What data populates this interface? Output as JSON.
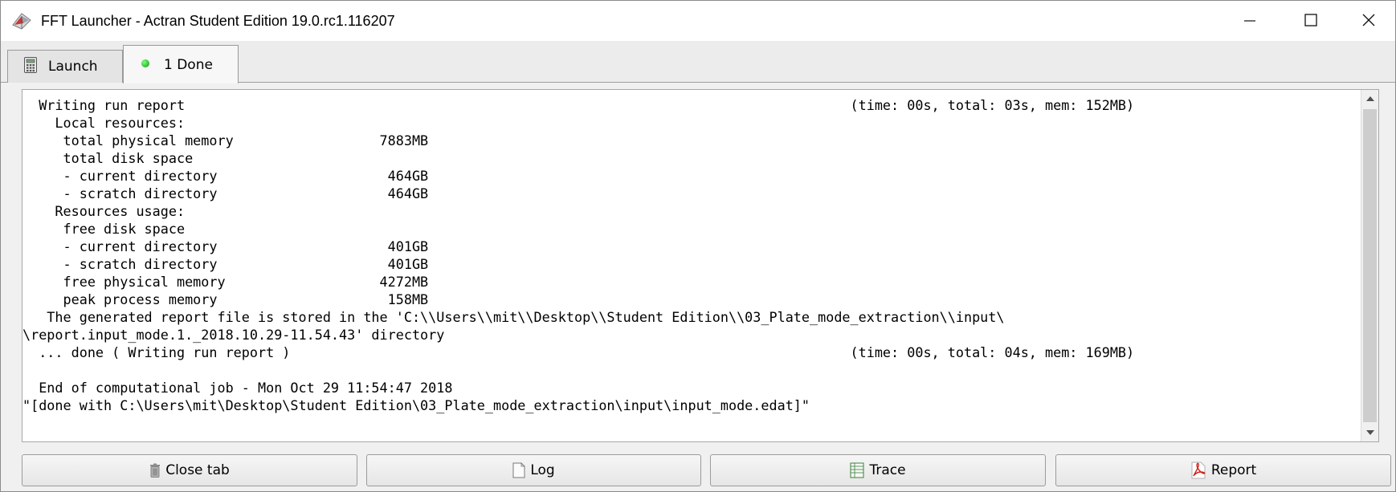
{
  "window": {
    "title": "FFT Launcher - Actran Student Edition 19.0.rc1.116207",
    "controls": {
      "minimize": "—",
      "maximize": "☐",
      "close": "✕"
    }
  },
  "tabs": [
    {
      "label": "Launch",
      "icon": "calculator-icon"
    },
    {
      "label": "1 Done",
      "icon": "green-status-dot-icon",
      "status_color": "#1aa51a"
    }
  ],
  "log": {
    "lines": [
      "  Writing run report                                                                                  (time: 00s, total: 03s, mem: 152MB)",
      "    Local resources:",
      "     total physical memory                  7883MB",
      "     total disk space",
      "     - current directory                     464GB",
      "     - scratch directory                     464GB",
      "    Resources usage:",
      "     free disk space",
      "     - current directory                     401GB",
      "     - scratch directory                     401GB",
      "     free physical memory                   4272MB",
      "     peak process memory                     158MB",
      "   The generated report file is stored in the 'C:\\\\Users\\\\mit\\\\Desktop\\\\Student Edition\\\\03_Plate_mode_extraction\\\\input\\",
      "\\report.input_mode.1._2018.10.29-11.54.43' directory",
      "  ... done ( Writing run report )                                                                     (time: 00s, total: 04s, mem: 169MB)",
      "",
      "  End of computational job - Mon Oct 29 11:54:47 2018",
      "\"[done with C:\\Users\\mit\\Desktop\\Student Edition\\03_Plate_mode_extraction\\input\\input_mode.edat]\""
    ]
  },
  "buttons": {
    "close_tab": {
      "label": "Close tab",
      "icon": "trash-can-icon"
    },
    "log": {
      "label": "Log",
      "icon": "document-icon"
    },
    "trace": {
      "label": "Trace",
      "icon": "spreadsheet-icon"
    },
    "report": {
      "label": "Report",
      "icon": "pdf-icon"
    }
  }
}
